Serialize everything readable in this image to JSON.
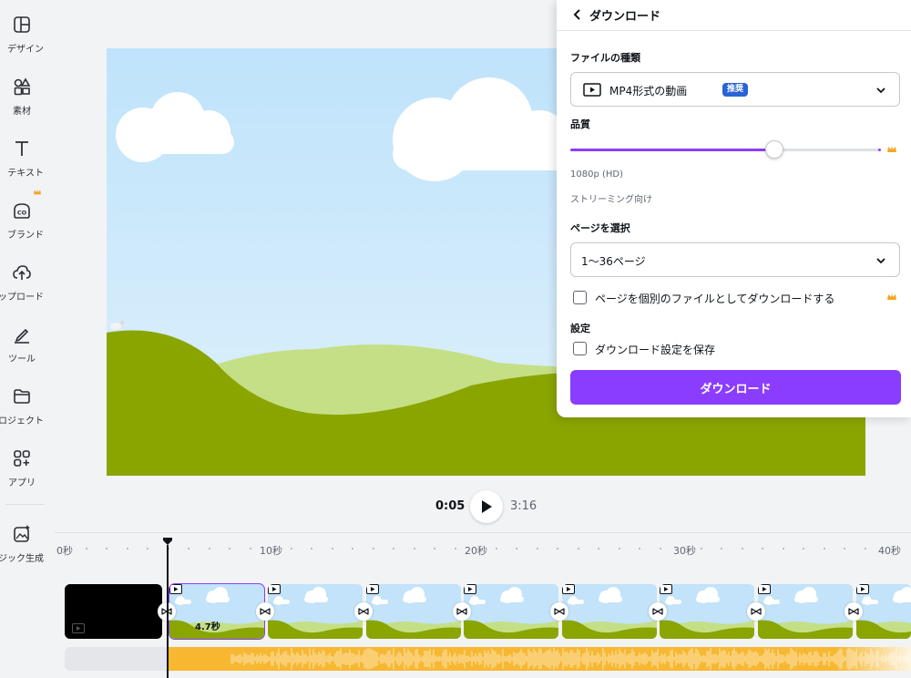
{
  "sidebar": {
    "items": [
      {
        "label": "デザイン",
        "icon": "layout-icon"
      },
      {
        "label": "素材",
        "icon": "elements-icon"
      },
      {
        "label": "テキスト",
        "icon": "text-icon"
      },
      {
        "label": "ブランド",
        "icon": "brand-icon"
      },
      {
        "label": "ップロード",
        "icon": "upload-icon"
      },
      {
        "label": "ツール",
        "icon": "draw-tool-icon"
      },
      {
        "label": "ロジェクト",
        "icon": "folder-icon"
      },
      {
        "label": "アプリ",
        "icon": "apps-icon"
      },
      {
        "label": "ジック生成",
        "icon": "magic-media-icon"
      }
    ]
  },
  "player": {
    "current_time": "0:05",
    "total_time": "3:16"
  },
  "timeline": {
    "ticks": [
      "0秒",
      "10秒",
      "20秒",
      "30秒",
      "40秒"
    ],
    "selected_clip_duration": "4.7秒"
  },
  "download_panel": {
    "title": "ダウンロード",
    "file_type_label": "ファイルの種類",
    "file_type_value": "MP4形式の動画",
    "file_type_badge": "推奨",
    "quality_label": "品質",
    "quality_level": 0.66,
    "quality_value": "1080p (HD)",
    "quality_note": "ストリーミング向け",
    "page_select_label": "ページを選択",
    "page_select_value": "1〜36ページ",
    "separate_files_label": "ページを個別のファイルとしてダウンロードする",
    "separate_files_checked": false,
    "settings_label": "設定",
    "save_settings_label": "ダウンロード設定を保存",
    "save_settings_checked": false,
    "download_button": "ダウンロード"
  },
  "colors": {
    "accent": "#8b3dff",
    "badge": "#2a63d4",
    "audio": "#f7b731",
    "crown": "#f5a623"
  }
}
